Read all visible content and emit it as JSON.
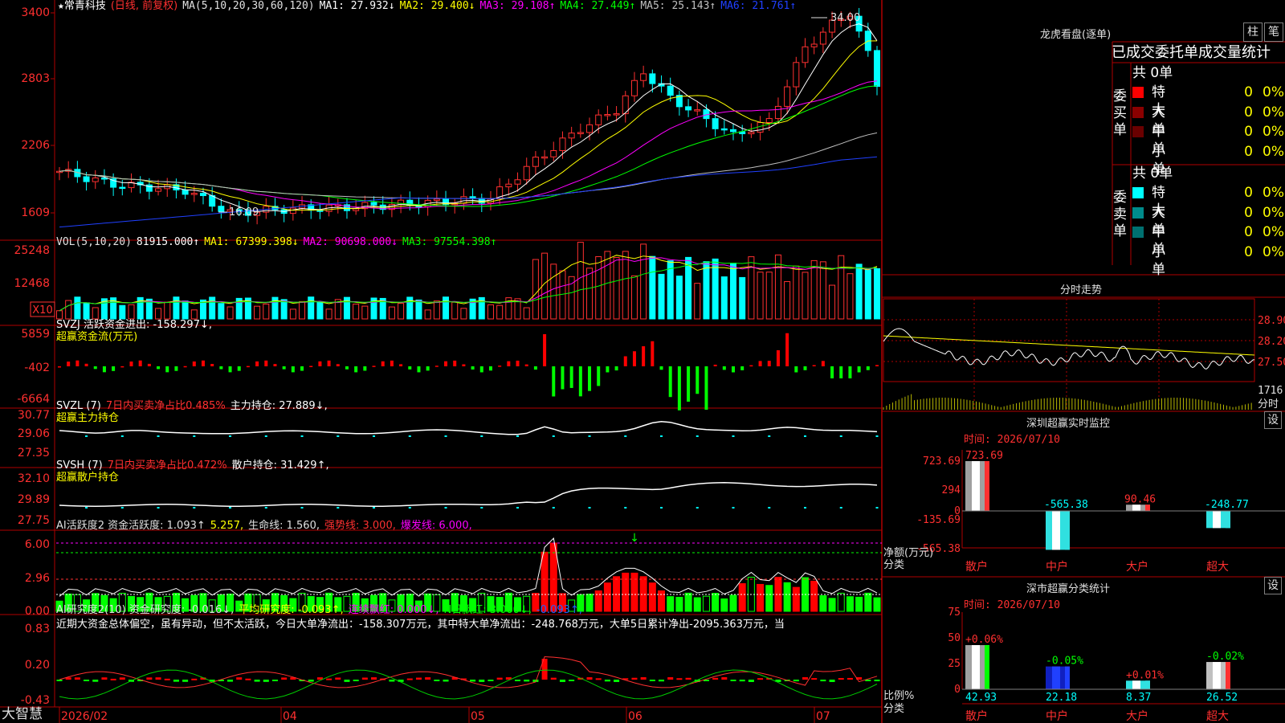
{
  "app": {
    "brand": "大智慧"
  },
  "stock": {
    "name": "常青科技",
    "mode": "(日线, 前复权)"
  },
  "price_panel": {
    "ma_label": "MA(5,10,20,30,60,120)",
    "ma_values": [
      {
        "label": "MA1: 27.932↓",
        "color": "#ffffff"
      },
      {
        "label": "MA2: 29.400↓",
        "color": "#ffff00"
      },
      {
        "label": "MA3: 29.108↑",
        "color": "#ff00ff"
      },
      {
        "label": "MA4: 27.449↑",
        "color": "#00ff00"
      },
      {
        "label": "MA5: 25.143↑",
        "color": "#c0c0c0"
      },
      {
        "label": "MA6: 21.761↑",
        "color": "#2040ff"
      }
    ],
    "y_ticks": [
      "3400",
      "2803",
      "2206",
      "1609"
    ],
    "high_label": "34.00",
    "low_label": "16.09"
  },
  "vol_panel": {
    "header": "VOL(5,10,20)",
    "current": "81915.000↑",
    "ma_values": [
      {
        "label": "MA1: 67399.398↓",
        "color": "#ffff00"
      },
      {
        "label": "MA2: 90698.000↓",
        "color": "#ff00ff"
      },
      {
        "label": "MA3: 97554.398↑",
        "color": "#00ff00"
      }
    ],
    "y_ticks": [
      "25248",
      "12468"
    ],
    "unit": "X10"
  },
  "svzj_panel": {
    "header": "SVZJ 活跃资金进出: -158.297↓,",
    "subtitle": "超赢资金流(万元)",
    "y_ticks": [
      "5859",
      "-402",
      "-6664"
    ]
  },
  "svzl_panel": {
    "header1": "SVZL (7)",
    "header2": "7日内买卖净占比0.485%",
    "header3": "主力持仓: 27.889↓,",
    "subtitle": "超赢主力持仓",
    "y_ticks": [
      "30.77",
      "29.06",
      "27.35"
    ]
  },
  "svsh_panel": {
    "header1": "SVSH (7)",
    "header2": "7日内买卖净占比0.472%",
    "header3": "散户持仓: 31.429↑,",
    "subtitle": "超赢散户持仓",
    "y_ticks": [
      "32.10",
      "29.89",
      "27.75"
    ]
  },
  "ai_active_panel": {
    "items": [
      {
        "label": "AI活跃度2 资金活跃度: 1.093↑",
        "color": "#e0e0e0"
      },
      {
        "label": "5.257,",
        "color": "#ffff00"
      },
      {
        "label": "生命线: 1.560,",
        "color": "#e0e0e0"
      },
      {
        "label": "强势线: 3.000,",
        "color": "#ff3030"
      },
      {
        "label": "爆发线: 6.000,",
        "color": "#ff00ff"
      }
    ],
    "y_ticks": [
      "6.00",
      "2.96",
      "0.00"
    ]
  },
  "ai_research_panel": {
    "items": [
      {
        "label": "AI研究度2(10) 资金研究度: -0.016↓,",
        "color": "#e0e0e0"
      },
      {
        "label": "平均研究度: -0.093↑,",
        "color": "#ffff00"
      },
      {
        "label": "连续飘红: 0.000↓,",
        "color": "#ff00ff"
      },
      {
        "label": "N日飘红: 3.000↓,",
        "color": "#00ff00"
      },
      {
        "label": "-0.093↑,",
        "color": "#2060ff"
      }
    ],
    "comment": "近期大资金总体偏空，虽有异动，但不太活跃，今日大单净流出：-158.307万元，其中特大单净流出：-248.768万元，大单5日累计净出-2095.363万元，当",
    "y_ticks": [
      "0.83",
      "0.20",
      "-0.43"
    ]
  },
  "x_axis": {
    "labels": [
      "2026/02",
      "04",
      "05",
      "06",
      "07"
    ]
  },
  "longhu": {
    "title": "龙虎看盘(逐单)",
    "btn_bar": "柱",
    "btn_pen": "笔",
    "col_headers": "已成交委托单成交量统计",
    "buy": {
      "label": "委买单",
      "total": "共 0单",
      "rows": [
        {
          "name": "特大",
          "count": "0",
          "pct": "0%",
          "color": "#ff0000"
        },
        {
          "name": "大单",
          "count": "0",
          "pct": "0%",
          "color": "#8b0000"
        },
        {
          "name": "中单",
          "count": "0",
          "pct": "0%",
          "color": "#6a0000"
        },
        {
          "name": "小单",
          "count": "0",
          "pct": "0%",
          "color": "#000000"
        }
      ]
    },
    "sell": {
      "label": "委卖单",
      "total": "共 0单",
      "rows": [
        {
          "name": "特大",
          "count": "0",
          "pct": "0%",
          "color": "#00ffff"
        },
        {
          "name": "大单",
          "count": "0",
          "pct": "0%",
          "color": "#008b8b"
        },
        {
          "name": "中单",
          "count": "0",
          "pct": "0%",
          "color": "#007070"
        },
        {
          "name": "小单",
          "count": "0",
          "pct": "0%",
          "color": "#000000"
        }
      ]
    }
  },
  "intraday": {
    "title": "分时走势",
    "y_ticks": [
      "28.90",
      "28.20",
      "27.50"
    ],
    "vol_tick": "1716",
    "label": "分时"
  },
  "sz_monitor": {
    "title": "深圳超赢实时监控",
    "settings": "设",
    "time": "时间: 2026/07/10",
    "y_ticks": [
      "723.69",
      "294",
      "0",
      "-135.69",
      "-565.38"
    ],
    "axis_label": "净额(万元)",
    "axis_label2": "分类",
    "bars": [
      {
        "cat": "散户",
        "value": 723.69,
        "label": "723.69"
      },
      {
        "cat": "中户",
        "value": -565.38,
        "label": "-565.38"
      },
      {
        "cat": "大户",
        "value": 90.46,
        "label": "90.46"
      },
      {
        "cat": "超大",
        "value": -248.77,
        "label": "-248.77"
      }
    ]
  },
  "sz_class": {
    "title": "深市超赢分类统计",
    "settings": "设",
    "time": "时间: 2026/07/10",
    "y_ticks": [
      "75",
      "50",
      "25",
      "0"
    ],
    "axis_label": "比例%",
    "axis_label2": "分类",
    "bars": [
      {
        "cat": "散户",
        "value": 42.93,
        "label": "42.93",
        "change": "+0.06%"
      },
      {
        "cat": "中户",
        "value": 22.18,
        "label": "22.18",
        "change": "-0.05%"
      },
      {
        "cat": "大户",
        "value": 8.37,
        "label": "8.37",
        "change": "+0.01%"
      },
      {
        "cat": "超大",
        "value": 26.52,
        "label": "26.52",
        "change": "-0.02%"
      }
    ]
  },
  "colors": {
    "grid": "#b00000",
    "up": "#ff3030",
    "down": "#00ffff",
    "text": "#c0c0c0"
  }
}
